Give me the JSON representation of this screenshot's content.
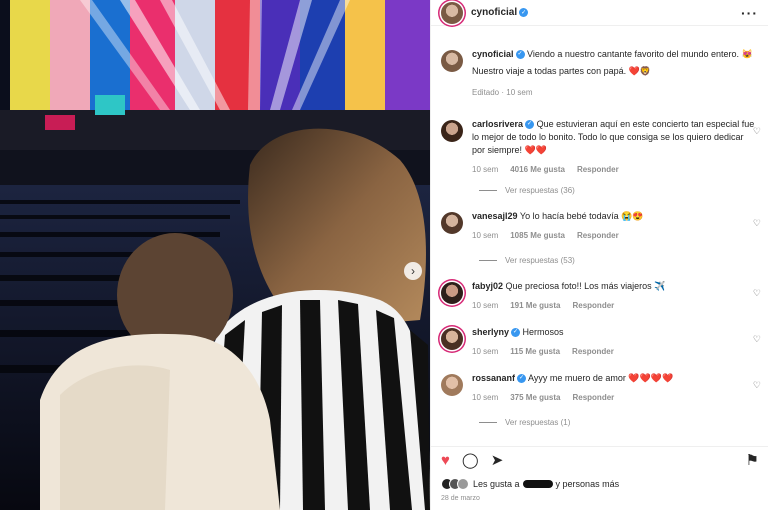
{
  "post": {
    "username": "cynoficial",
    "more_icon": "more-horizontal-icon",
    "caption": "Viendo a nuestro cantante favorito del mundo entero. 😻",
    "caption2": "Nuestro viaje a todas partes con papá. ❤️🦁",
    "edited": "Editado · 10 sem",
    "likes_prefix": "Les gusta a",
    "likes_suffix": "y personas más",
    "date": "28 de marzo"
  },
  "comments": [
    {
      "user": "carlosrivera",
      "verified": true,
      "text": "Que estuvieran aquí en este concierto tan especial fue lo mejor de todo lo bonito. Todo lo que consiga se los quiero dedicar por siempre! ❤️❤️",
      "time": "10 sem",
      "likes": "4016 Me gusta",
      "reply": "Responder",
      "replies": "Ver respuestas (36)"
    },
    {
      "user": "vanesajl29",
      "verified": false,
      "text": "Yo lo hacía bebé todavía 😭😍",
      "time": "10 sem",
      "likes": "1085 Me gusta",
      "reply": "Responder",
      "replies": "Ver respuestas (53)"
    },
    {
      "user": "fabyj02",
      "verified": false,
      "text": "Que preciosa foto!! Los más viajeros ✈️",
      "time": "10 sem",
      "likes": "191 Me gusta",
      "reply": "Responder"
    },
    {
      "user": "sherlyny",
      "verified": true,
      "text": "Hermosos",
      "time": "10 sem",
      "likes": "115 Me gusta",
      "reply": "Responder"
    },
    {
      "user": "rossananf",
      "verified": true,
      "text": "Ayyy me muero de amor ❤️❤️❤️❤️",
      "time": "10 sem",
      "likes": "375 Me gusta",
      "reply": "Responder",
      "replies": "Ver respuestas (1)"
    }
  ],
  "colors": {
    "accent": "#3897f0",
    "like": "#ed4956",
    "muted": "#8e8e8e"
  }
}
